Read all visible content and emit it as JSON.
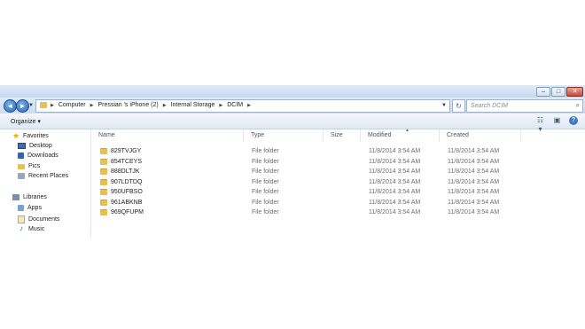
{
  "caption": {
    "minimize": "–",
    "maximize": "□",
    "close": "✕"
  },
  "address": {
    "back_icon": "back-arrow-icon",
    "forward_icon": "forward-arrow-icon",
    "crumbs": [
      "Computer",
      "Pressian 's iPhone (2)",
      "Internal Storage",
      "DCIM"
    ],
    "search_placeholder": "Search DCIM"
  },
  "toolbar": {
    "organize": "Organize ▾"
  },
  "sidebar": {
    "favorites": {
      "label": "Favorites",
      "items": [
        "Desktop",
        "Downloads",
        "Pics",
        "Recent Places"
      ]
    },
    "libraries": {
      "label": "Libraries",
      "items": [
        "Apps",
        "Documents",
        "Music"
      ]
    }
  },
  "columns": {
    "name": "Name",
    "type": "Type",
    "size": "Size",
    "modified": "Modified",
    "created": "Created"
  },
  "files": [
    {
      "name": "829TVJGY",
      "type": "File folder",
      "modified": "11/8/2014 3:54 AM",
      "created": "11/8/2014 3:54 AM"
    },
    {
      "name": "854TCEYS",
      "type": "File folder",
      "modified": "11/8/2014 3:54 AM",
      "created": "11/8/2014 3:54 AM"
    },
    {
      "name": "888DLTJK",
      "type": "File folder",
      "modified": "11/8/2014 3:54 AM",
      "created": "11/8/2014 3:54 AM"
    },
    {
      "name": "907LDTDQ",
      "type": "File folder",
      "modified": "11/8/2014 3:54 AM",
      "created": "11/8/2014 3:54 AM"
    },
    {
      "name": "950UFBSO",
      "type": "File folder",
      "modified": "11/8/2014 3:54 AM",
      "created": "11/8/2014 3:54 AM"
    },
    {
      "name": "961ABKNB",
      "type": "File folder",
      "modified": "11/8/2014 3:54 AM",
      "created": "11/8/2014 3:54 AM"
    },
    {
      "name": "969QFUPM",
      "type": "File folder",
      "modified": "11/8/2014 3:54 AM",
      "created": "11/8/2014 3:54 AM"
    }
  ]
}
